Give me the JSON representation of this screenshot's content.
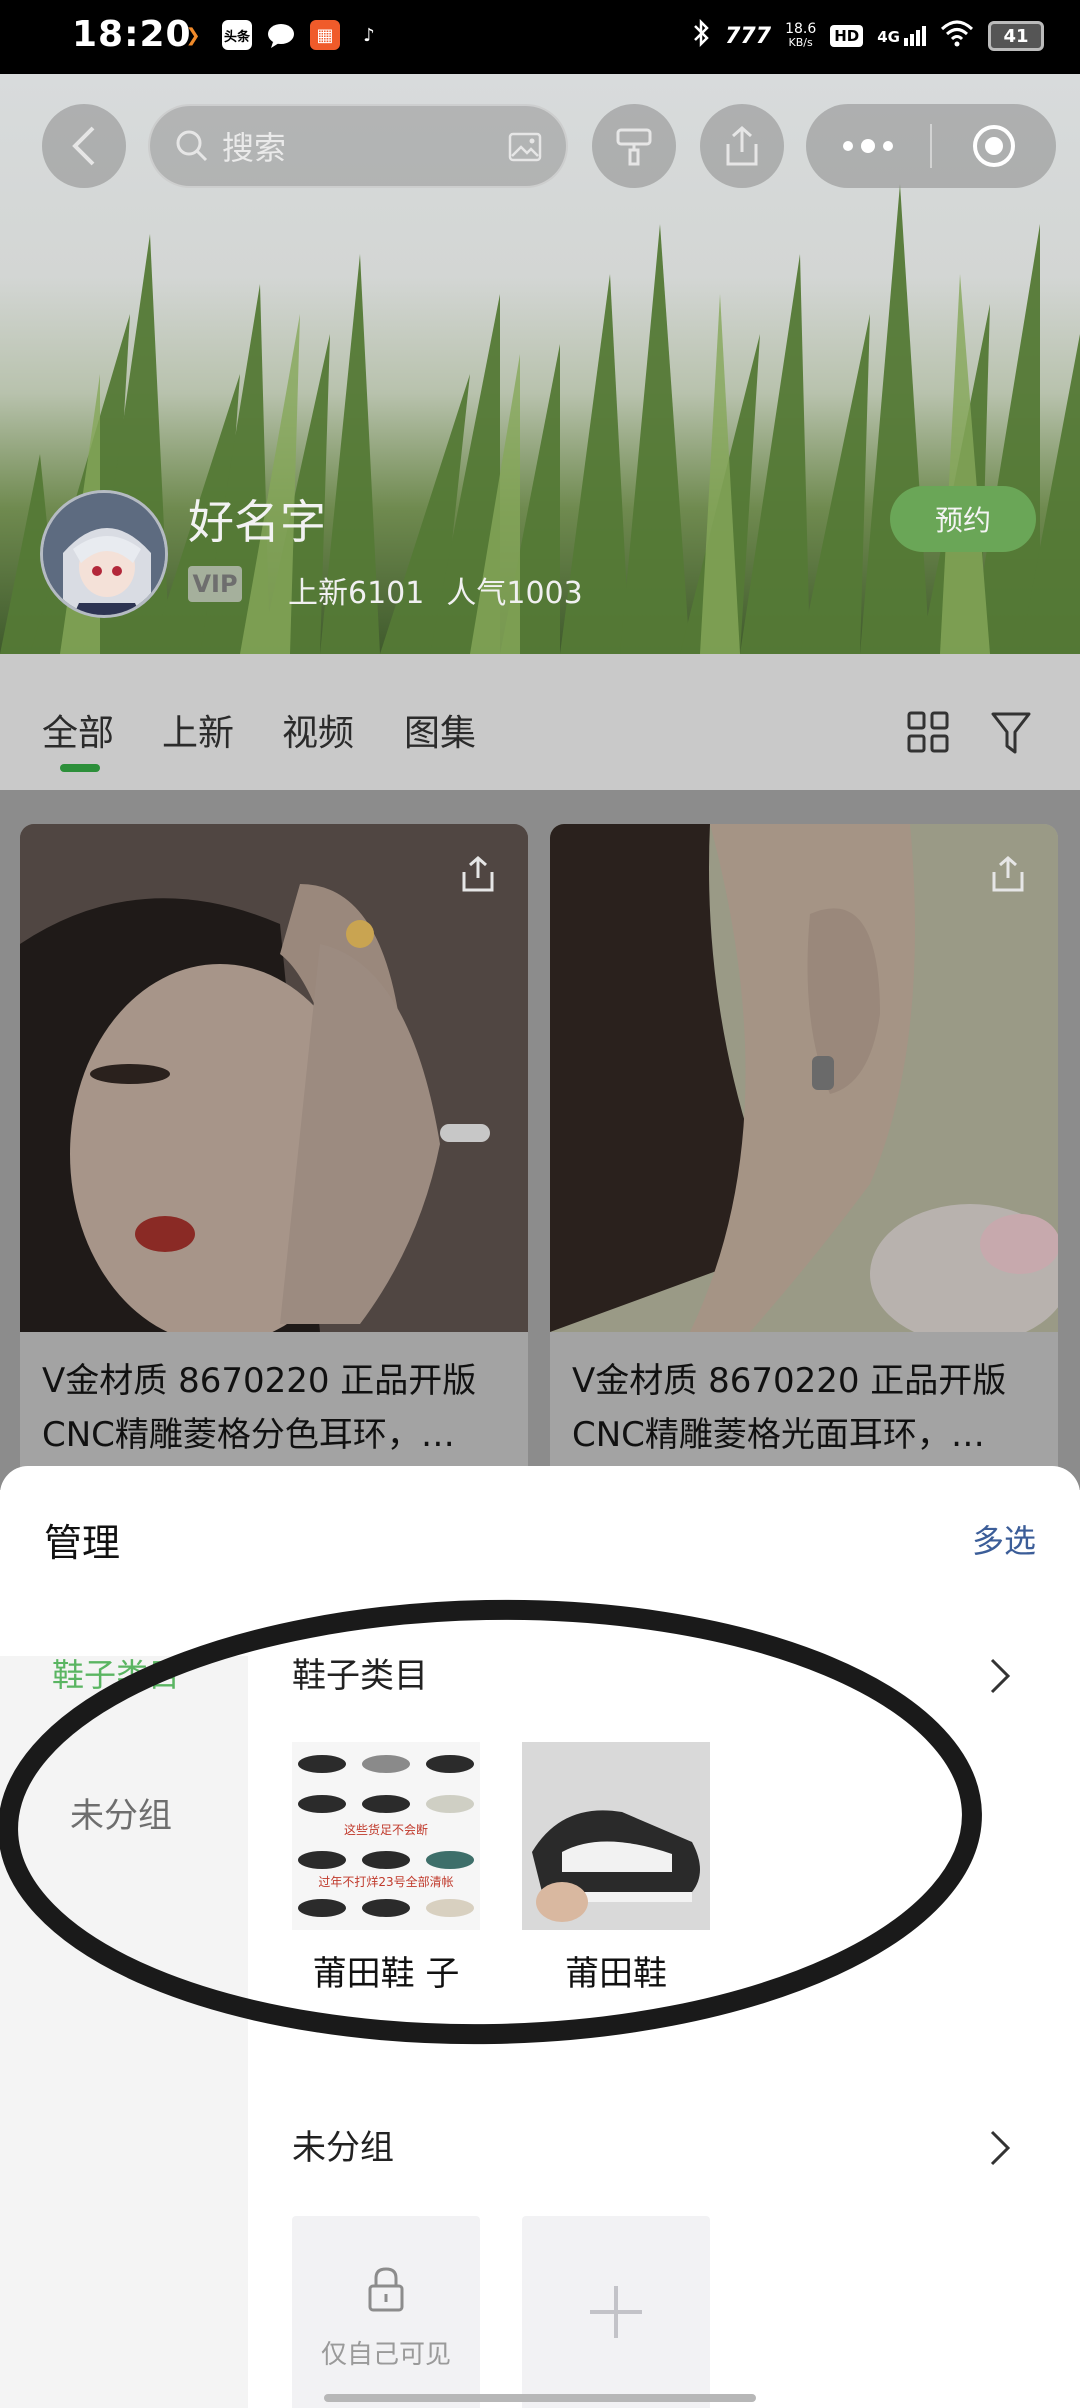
{
  "status_bar": {
    "time": "18:20",
    "icons_left": [
      "app-orange-icon",
      "toutiao-icon",
      "chat-bubble-icon",
      "app-grid-icon",
      "tiktok-icon"
    ],
    "toutiao_text": "头条",
    "net_speed": "18.6",
    "net_unit": "KB/s",
    "hd": "HD",
    "signal": "4G",
    "battery": "41"
  },
  "top_nav": {
    "search_placeholder": "搜索"
  },
  "shop": {
    "name": "好名字",
    "vip": "VIP",
    "new_count": "上新6101",
    "popularity": "人气1003",
    "reserve_label": "预约"
  },
  "tabs": [
    {
      "label": "全部",
      "active": true
    },
    {
      "label": "上新",
      "active": false
    },
    {
      "label": "视频",
      "active": false
    },
    {
      "label": "图集",
      "active": false
    }
  ],
  "products": [
    {
      "title_line1": "V金材质 8670220 正品开版",
      "title_line2": "CNC精雕菱格分色耳环，…"
    },
    {
      "title_line1": "V金材质 8670220 正品开版",
      "title_line2": "CNC精雕菱格光面耳环，…"
    }
  ],
  "sheet": {
    "title": "管理",
    "multi_select": "多选",
    "sidebar": {
      "active_label": "鞋子类目",
      "item_label": "未分组"
    },
    "groups": [
      {
        "name": "鞋子类目",
        "items": [
          {
            "label": "莆田鞋 子",
            "overlay_line1": "这些货足不会断",
            "overlay_line2": "过年不打烊23号全部清帐"
          },
          {
            "label": "莆田鞋"
          }
        ]
      },
      {
        "name": "未分组",
        "private_label": "仅自己可见"
      }
    ]
  },
  "colors": {
    "accent_green": "#5ab562",
    "link_blue": "#3b5d98",
    "reserve_green": "#6aa657"
  }
}
